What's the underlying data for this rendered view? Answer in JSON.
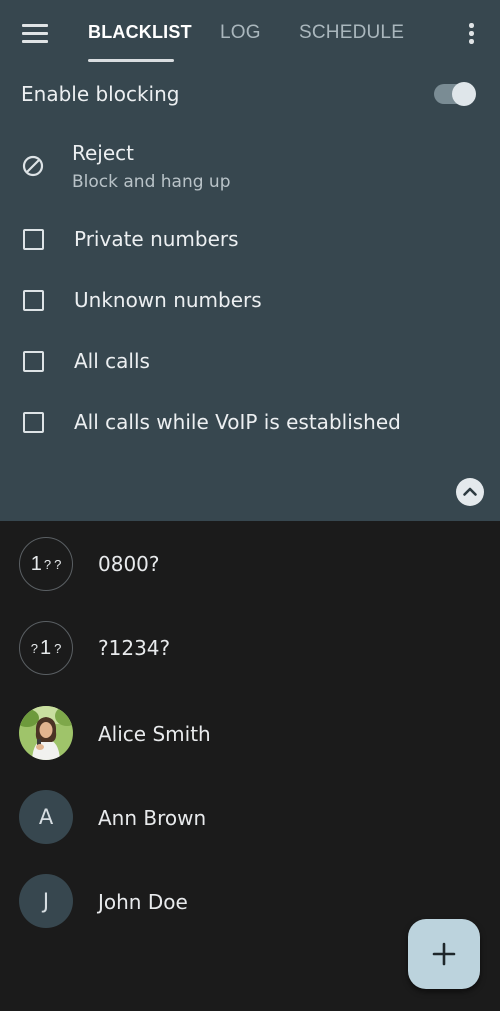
{
  "toolbar": {
    "tabs": [
      {
        "label": "BLACKLIST",
        "active": true
      },
      {
        "label": "LOG",
        "active": false
      },
      {
        "label": "SCHEDULE",
        "active": false
      }
    ],
    "icons": {
      "menu": "hamburger-menu-icon",
      "overflow": "more-vert-icon"
    }
  },
  "settings": {
    "enable_blocking": {
      "label": "Enable blocking",
      "on": true
    },
    "reject": {
      "title": "Reject",
      "subtitle": "Block and hang up",
      "icon": "block-icon"
    },
    "options": [
      {
        "label": "Private numbers",
        "checked": false
      },
      {
        "label": "Unknown numbers",
        "checked": false
      },
      {
        "label": "All calls",
        "checked": false
      },
      {
        "label": "All calls while VoIP is established",
        "checked": false
      }
    ],
    "collapse_icon": "chevron-up-icon"
  },
  "blacklist": [
    {
      "label": "0800?",
      "avatar": {
        "type": "pattern",
        "glyphs": [
          "1",
          "?",
          "?"
        ]
      }
    },
    {
      "label": "?1234?",
      "avatar": {
        "type": "pattern",
        "glyphs": [
          "?",
          "1",
          "?"
        ]
      }
    },
    {
      "label": "Alice Smith",
      "avatar": {
        "type": "photo"
      }
    },
    {
      "label": "Ann Brown",
      "avatar": {
        "type": "letter",
        "letter": "A"
      }
    },
    {
      "label": "John Doe",
      "avatar": {
        "type": "letter",
        "letter": "J"
      }
    }
  ],
  "fab": {
    "icon": "add-icon"
  },
  "colors": {
    "panel": "#37474f",
    "background": "#1b1b1b",
    "fab": "#bcd3dd"
  }
}
